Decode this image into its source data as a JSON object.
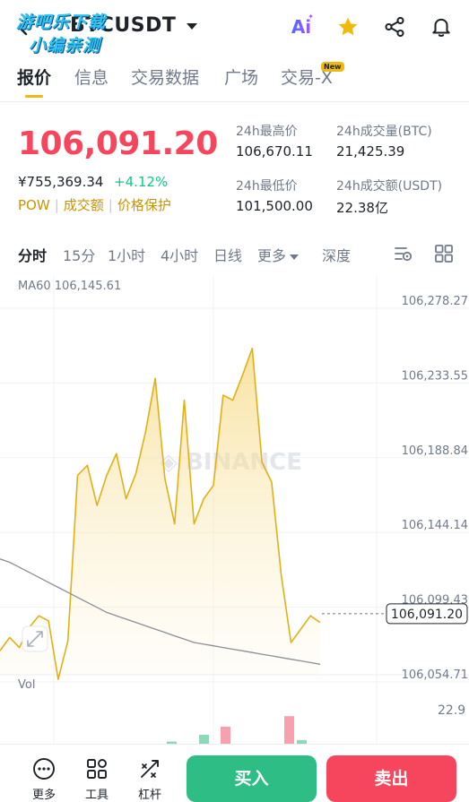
{
  "header": {
    "pair": "BTCUSDT",
    "watermark_line1": "游吧乐下载",
    "watermark_line2": "小编亲测",
    "ai_label": "Ai"
  },
  "tabs": [
    {
      "label": "报价",
      "active": true
    },
    {
      "label": "信息",
      "active": false
    },
    {
      "label": "交易数据",
      "active": false
    },
    {
      "label": "广场",
      "active": false
    },
    {
      "label": "交易-X",
      "active": false
    }
  ],
  "new_badge": "New",
  "ticker": {
    "price": "106,091.20",
    "price_cny": "¥755,369.34",
    "change_pct": "+4.12%",
    "tags": [
      "POW",
      "成交额",
      "价格保护"
    ],
    "high_label": "24h最高价",
    "high_value": "106,670.11",
    "low_label": "24h最低价",
    "low_value": "101,500.00",
    "vol_btc_label": "24h成交量(BTC)",
    "vol_btc_value": "21,425.39",
    "vol_usdt_label": "24h成交额(USDT)",
    "vol_usdt_value": "22.38亿"
  },
  "intervals": [
    {
      "label": "分时",
      "active": true
    },
    {
      "label": "15分",
      "active": false
    },
    {
      "label": "1小时",
      "active": false
    },
    {
      "label": "4小时",
      "active": false
    },
    {
      "label": "日线",
      "active": false
    },
    {
      "label": "更多",
      "active": false
    },
    {
      "label": "深度",
      "active": false
    }
  ],
  "chart_data": {
    "type": "area",
    "ma_label": "MA60 106,145.61",
    "watermark": "BINANCE",
    "y_ticks": [
      "106,278.27",
      "106,233.55",
      "106,188.84",
      "106,144.14",
      "106,099.43",
      "106,054.71"
    ],
    "ylim": [
      106054.71,
      106278.27
    ],
    "current_price_label": "106,091.20",
    "current_price": 106091.2,
    "price_series": [
      106069,
      106077,
      106071,
      106083,
      106090,
      106087,
      106052,
      106075,
      106174,
      106180,
      106156,
      106174,
      106187,
      106160,
      106175,
      106200,
      106232,
      106172,
      106145,
      106219,
      106145,
      106160,
      106168,
      106222,
      106219,
      106234,
      106250,
      106182,
      106170,
      106114,
      106074,
      106082,
      106090,
      106086
    ],
    "ma_series": [
      106124,
      106122,
      106119,
      106116,
      106113,
      106110,
      106107,
      106104,
      106101,
      106098,
      106095,
      106092,
      106090,
      106088,
      106086,
      106084,
      106082,
      106080,
      106078,
      106076,
      106074,
      106073,
      106072,
      106071,
      106070,
      106069,
      106068,
      106067,
      106066,
      106065,
      106064,
      106063,
      106062,
      106061
    ],
    "volume_label": "Vol",
    "volume_top": "22.9",
    "volume_bars": [
      {
        "value": 1.2,
        "up": true
      },
      {
        "value": 4.8,
        "up": true
      },
      {
        "value": 9.1,
        "up": false
      },
      {
        "value": 14.7,
        "up": false
      },
      {
        "value": 2.0,
        "up": true
      }
    ]
  },
  "bottom": {
    "more_label": "更多",
    "tools_label": "工具",
    "leverage_label": "杠杆",
    "buy_label": "买入",
    "sell_label": "卖出"
  },
  "colors": {
    "up": "#0ecb81",
    "down": "#f6465d",
    "accent": "#f0b90b",
    "line": "#e2b015"
  }
}
